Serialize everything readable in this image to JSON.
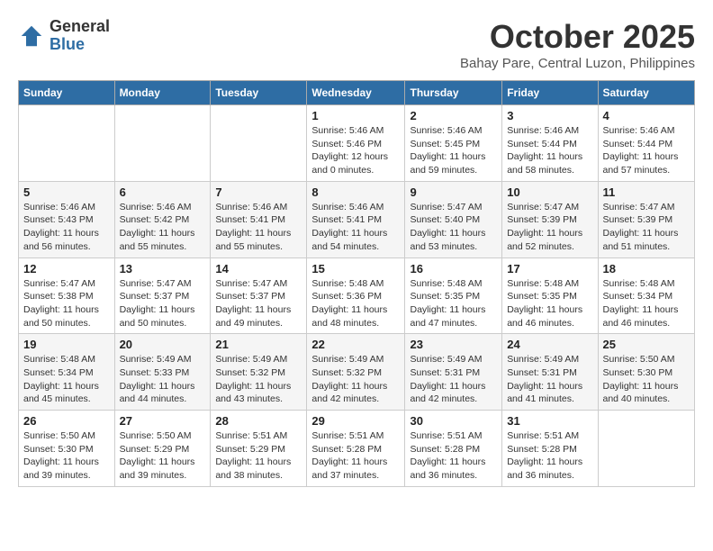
{
  "logo": {
    "general": "General",
    "blue": "Blue"
  },
  "title": "October 2025",
  "subtitle": "Bahay Pare, Central Luzon, Philippines",
  "headers": [
    "Sunday",
    "Monday",
    "Tuesday",
    "Wednesday",
    "Thursday",
    "Friday",
    "Saturday"
  ],
  "weeks": [
    [
      {
        "day": "",
        "sunrise": "",
        "sunset": "",
        "daylight": ""
      },
      {
        "day": "",
        "sunrise": "",
        "sunset": "",
        "daylight": ""
      },
      {
        "day": "",
        "sunrise": "",
        "sunset": "",
        "daylight": ""
      },
      {
        "day": "1",
        "sunrise": "Sunrise: 5:46 AM",
        "sunset": "Sunset: 5:46 PM",
        "daylight": "Daylight: 12 hours and 0 minutes."
      },
      {
        "day": "2",
        "sunrise": "Sunrise: 5:46 AM",
        "sunset": "Sunset: 5:45 PM",
        "daylight": "Daylight: 11 hours and 59 minutes."
      },
      {
        "day": "3",
        "sunrise": "Sunrise: 5:46 AM",
        "sunset": "Sunset: 5:44 PM",
        "daylight": "Daylight: 11 hours and 58 minutes."
      },
      {
        "day": "4",
        "sunrise": "Sunrise: 5:46 AM",
        "sunset": "Sunset: 5:44 PM",
        "daylight": "Daylight: 11 hours and 57 minutes."
      }
    ],
    [
      {
        "day": "5",
        "sunrise": "Sunrise: 5:46 AM",
        "sunset": "Sunset: 5:43 PM",
        "daylight": "Daylight: 11 hours and 56 minutes."
      },
      {
        "day": "6",
        "sunrise": "Sunrise: 5:46 AM",
        "sunset": "Sunset: 5:42 PM",
        "daylight": "Daylight: 11 hours and 55 minutes."
      },
      {
        "day": "7",
        "sunrise": "Sunrise: 5:46 AM",
        "sunset": "Sunset: 5:41 PM",
        "daylight": "Daylight: 11 hours and 55 minutes."
      },
      {
        "day": "8",
        "sunrise": "Sunrise: 5:46 AM",
        "sunset": "Sunset: 5:41 PM",
        "daylight": "Daylight: 11 hours and 54 minutes."
      },
      {
        "day": "9",
        "sunrise": "Sunrise: 5:47 AM",
        "sunset": "Sunset: 5:40 PM",
        "daylight": "Daylight: 11 hours and 53 minutes."
      },
      {
        "day": "10",
        "sunrise": "Sunrise: 5:47 AM",
        "sunset": "Sunset: 5:39 PM",
        "daylight": "Daylight: 11 hours and 52 minutes."
      },
      {
        "day": "11",
        "sunrise": "Sunrise: 5:47 AM",
        "sunset": "Sunset: 5:39 PM",
        "daylight": "Daylight: 11 hours and 51 minutes."
      }
    ],
    [
      {
        "day": "12",
        "sunrise": "Sunrise: 5:47 AM",
        "sunset": "Sunset: 5:38 PM",
        "daylight": "Daylight: 11 hours and 50 minutes."
      },
      {
        "day": "13",
        "sunrise": "Sunrise: 5:47 AM",
        "sunset": "Sunset: 5:37 PM",
        "daylight": "Daylight: 11 hours and 50 minutes."
      },
      {
        "day": "14",
        "sunrise": "Sunrise: 5:47 AM",
        "sunset": "Sunset: 5:37 PM",
        "daylight": "Daylight: 11 hours and 49 minutes."
      },
      {
        "day": "15",
        "sunrise": "Sunrise: 5:48 AM",
        "sunset": "Sunset: 5:36 PM",
        "daylight": "Daylight: 11 hours and 48 minutes."
      },
      {
        "day": "16",
        "sunrise": "Sunrise: 5:48 AM",
        "sunset": "Sunset: 5:35 PM",
        "daylight": "Daylight: 11 hours and 47 minutes."
      },
      {
        "day": "17",
        "sunrise": "Sunrise: 5:48 AM",
        "sunset": "Sunset: 5:35 PM",
        "daylight": "Daylight: 11 hours and 46 minutes."
      },
      {
        "day": "18",
        "sunrise": "Sunrise: 5:48 AM",
        "sunset": "Sunset: 5:34 PM",
        "daylight": "Daylight: 11 hours and 46 minutes."
      }
    ],
    [
      {
        "day": "19",
        "sunrise": "Sunrise: 5:48 AM",
        "sunset": "Sunset: 5:34 PM",
        "daylight": "Daylight: 11 hours and 45 minutes."
      },
      {
        "day": "20",
        "sunrise": "Sunrise: 5:49 AM",
        "sunset": "Sunset: 5:33 PM",
        "daylight": "Daylight: 11 hours and 44 minutes."
      },
      {
        "day": "21",
        "sunrise": "Sunrise: 5:49 AM",
        "sunset": "Sunset: 5:32 PM",
        "daylight": "Daylight: 11 hours and 43 minutes."
      },
      {
        "day": "22",
        "sunrise": "Sunrise: 5:49 AM",
        "sunset": "Sunset: 5:32 PM",
        "daylight": "Daylight: 11 hours and 42 minutes."
      },
      {
        "day": "23",
        "sunrise": "Sunrise: 5:49 AM",
        "sunset": "Sunset: 5:31 PM",
        "daylight": "Daylight: 11 hours and 42 minutes."
      },
      {
        "day": "24",
        "sunrise": "Sunrise: 5:49 AM",
        "sunset": "Sunset: 5:31 PM",
        "daylight": "Daylight: 11 hours and 41 minutes."
      },
      {
        "day": "25",
        "sunrise": "Sunrise: 5:50 AM",
        "sunset": "Sunset: 5:30 PM",
        "daylight": "Daylight: 11 hours and 40 minutes."
      }
    ],
    [
      {
        "day": "26",
        "sunrise": "Sunrise: 5:50 AM",
        "sunset": "Sunset: 5:30 PM",
        "daylight": "Daylight: 11 hours and 39 minutes."
      },
      {
        "day": "27",
        "sunrise": "Sunrise: 5:50 AM",
        "sunset": "Sunset: 5:29 PM",
        "daylight": "Daylight: 11 hours and 39 minutes."
      },
      {
        "day": "28",
        "sunrise": "Sunrise: 5:51 AM",
        "sunset": "Sunset: 5:29 PM",
        "daylight": "Daylight: 11 hours and 38 minutes."
      },
      {
        "day": "29",
        "sunrise": "Sunrise: 5:51 AM",
        "sunset": "Sunset: 5:28 PM",
        "daylight": "Daylight: 11 hours and 37 minutes."
      },
      {
        "day": "30",
        "sunrise": "Sunrise: 5:51 AM",
        "sunset": "Sunset: 5:28 PM",
        "daylight": "Daylight: 11 hours and 36 minutes."
      },
      {
        "day": "31",
        "sunrise": "Sunrise: 5:51 AM",
        "sunset": "Sunset: 5:28 PM",
        "daylight": "Daylight: 11 hours and 36 minutes."
      },
      {
        "day": "",
        "sunrise": "",
        "sunset": "",
        "daylight": ""
      }
    ]
  ]
}
